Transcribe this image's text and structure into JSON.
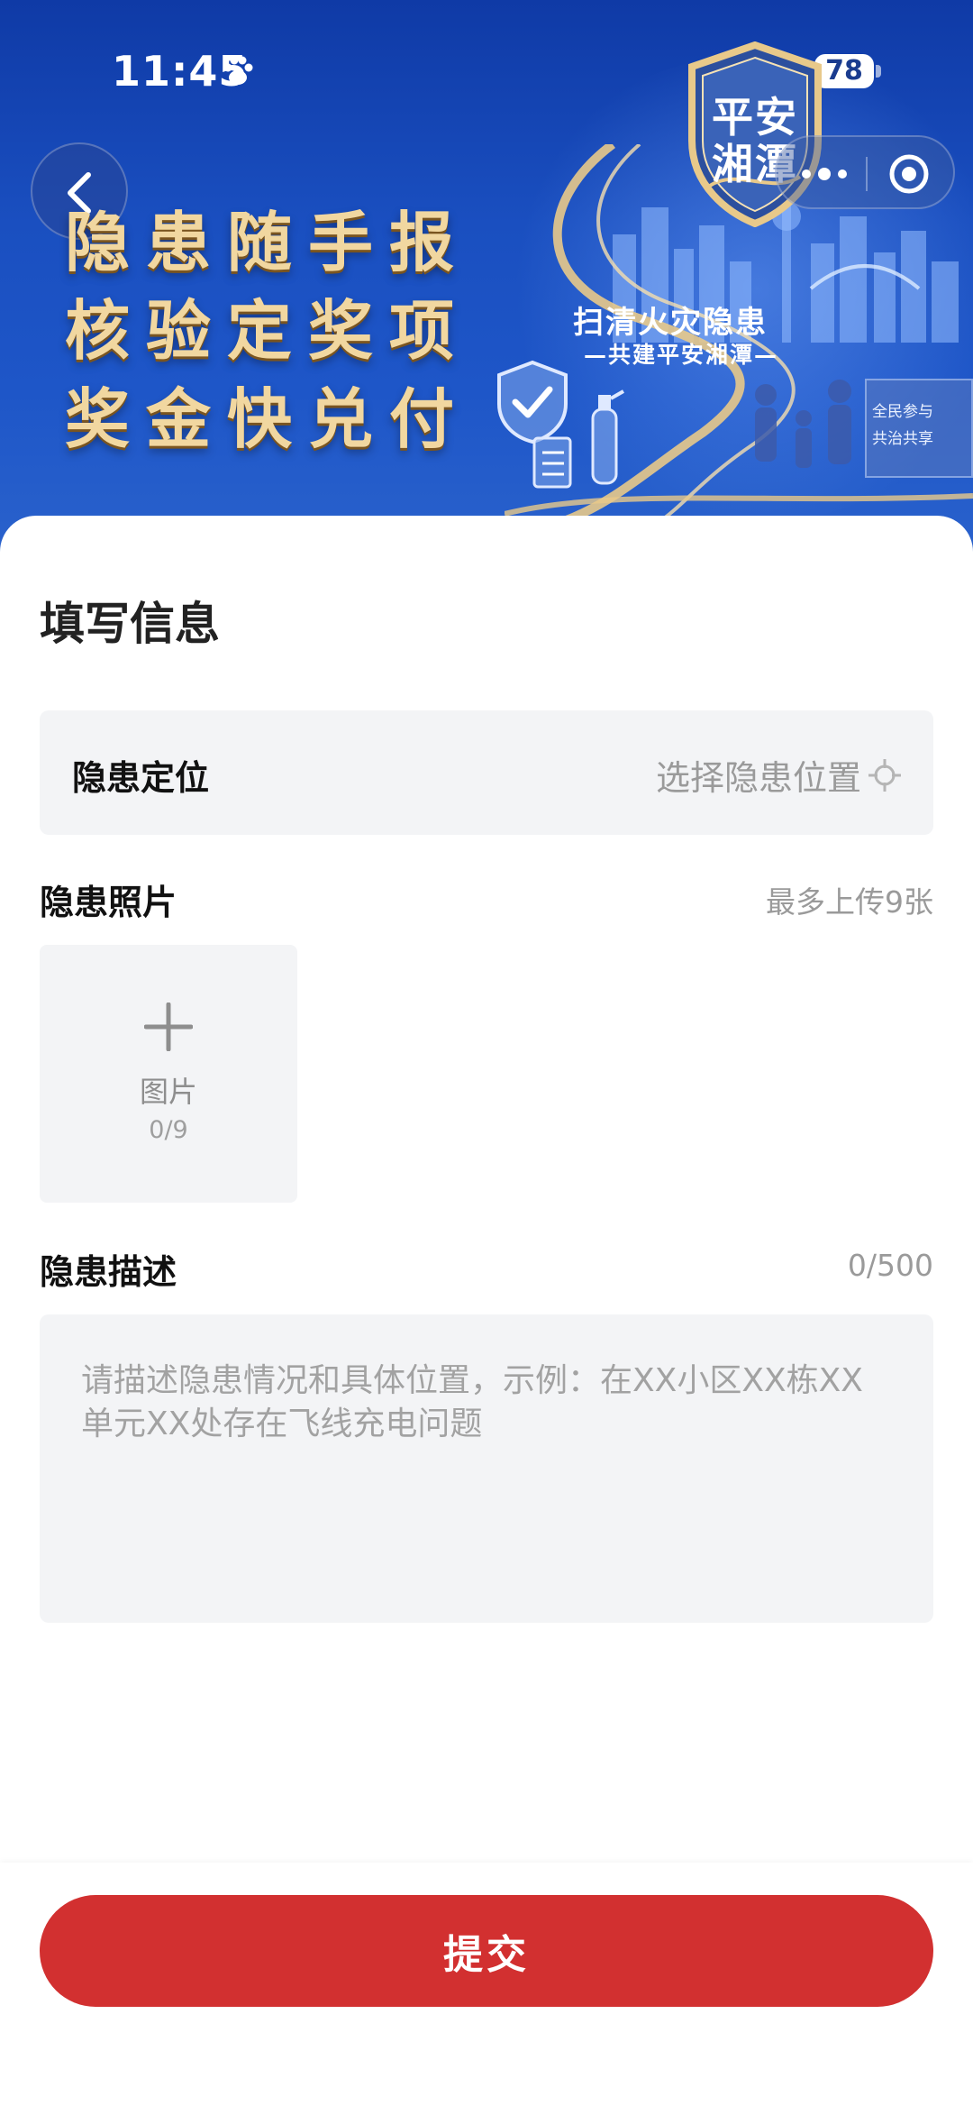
{
  "status_bar": {
    "time": "11:45",
    "battery": "78"
  },
  "banner": {
    "slogan": [
      "隐患随手报",
      "核验定奖项",
      "奖金快兑付"
    ],
    "shield_line1": "平安",
    "shield_line2": "湘潭",
    "sub_title": "扫清火灾隐患",
    "sub_caption": "—共建平安湘潭—",
    "sign_line1": "全民参与",
    "sign_line2": "共治共享"
  },
  "form": {
    "title": "填写信息",
    "location": {
      "label": "隐患定位",
      "placeholder": "选择隐患位置"
    },
    "photos": {
      "label": "隐患照片",
      "hint": "最多上传9张",
      "upload_label": "图片",
      "upload_count": "0/9"
    },
    "description": {
      "label": "隐患描述",
      "count": "0/500",
      "placeholder": "请描述隐患情况和具体位置，示例：在XX小区XX栋XX单元XX处存在飞线充电问题"
    }
  },
  "submit_label": "提交",
  "colors": {
    "primary": "#d23030",
    "banner_blue": "#1a4fc0",
    "gold": "#f1d7a0"
  }
}
